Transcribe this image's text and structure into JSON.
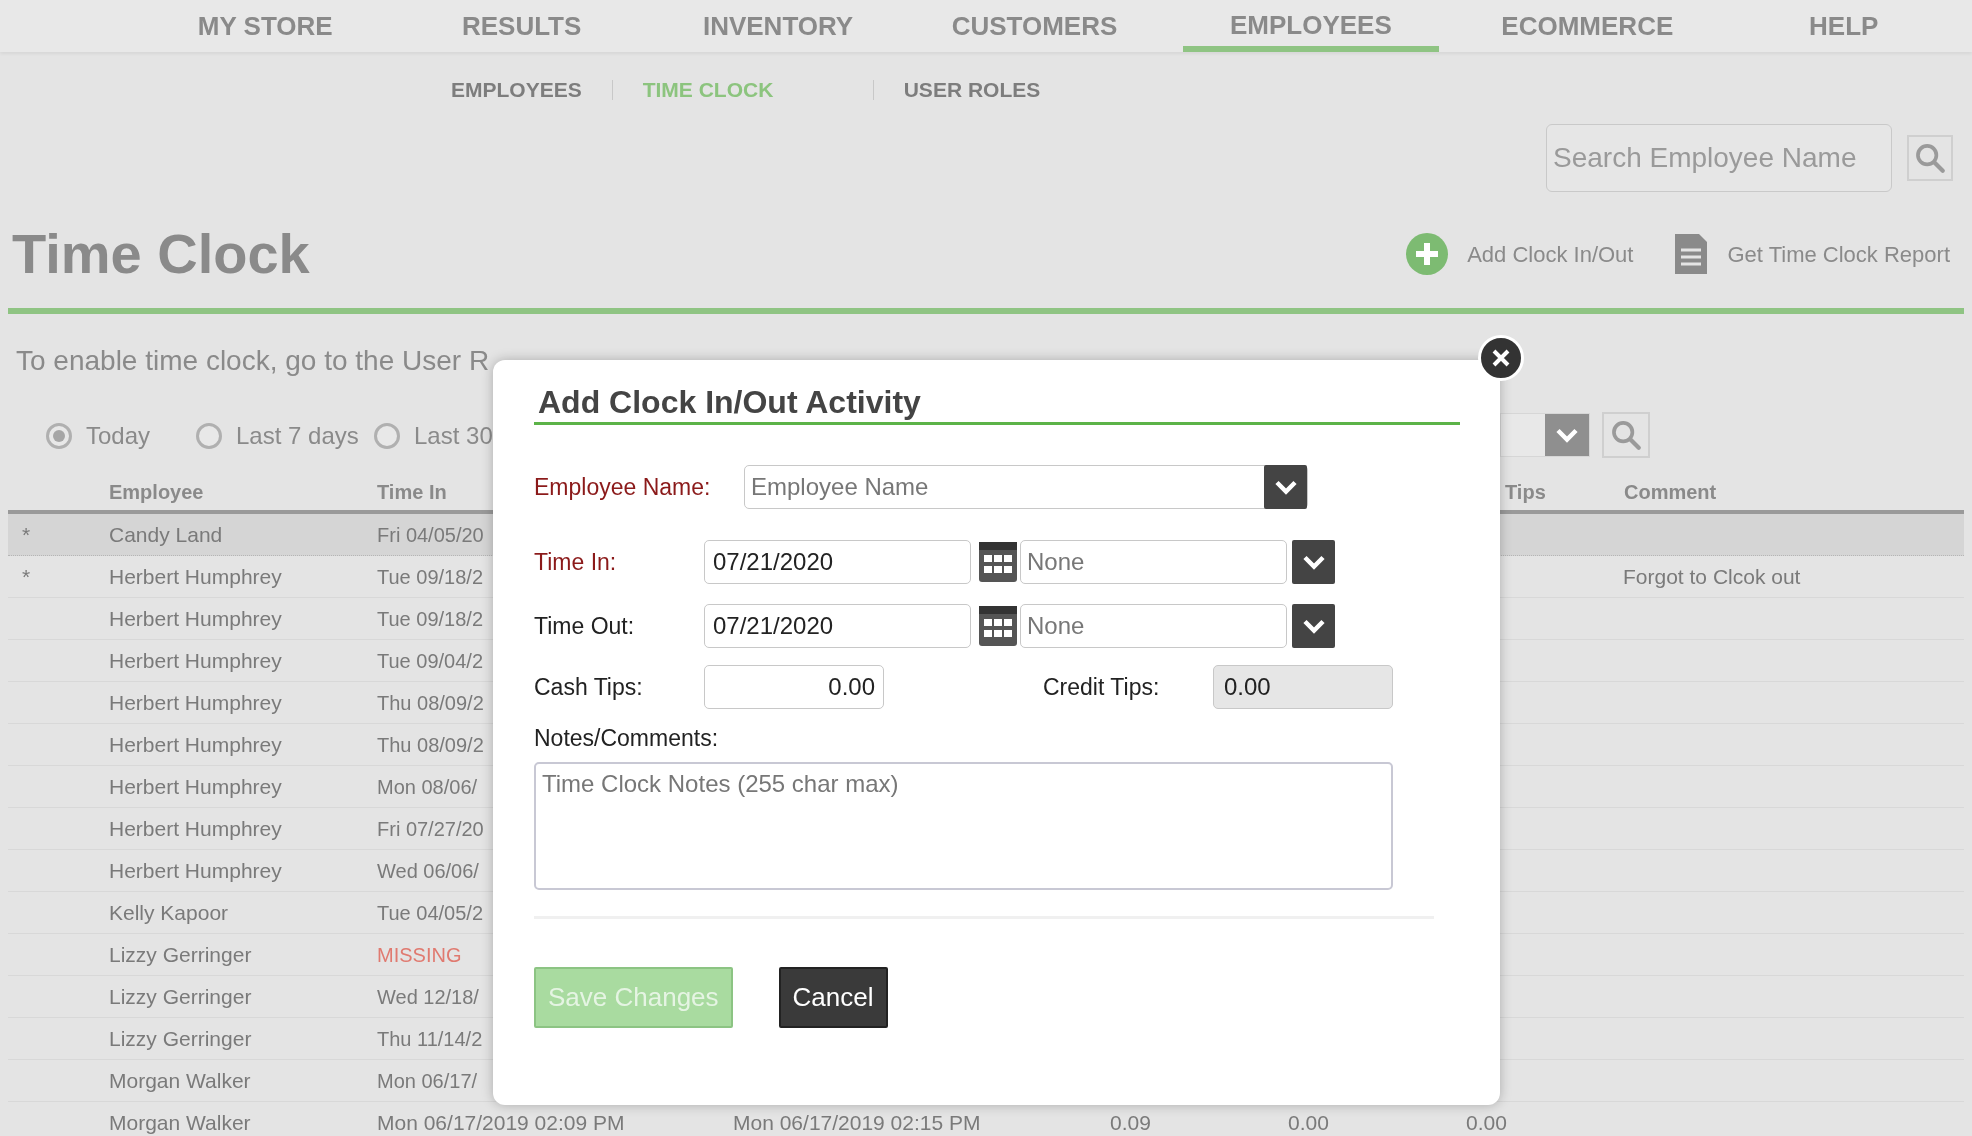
{
  "nav": [
    {
      "label": "MY STORE",
      "selected": false
    },
    {
      "label": "RESULTS",
      "selected": false
    },
    {
      "label": "INVENTORY",
      "selected": false
    },
    {
      "label": "CUSTOMERS",
      "selected": false
    },
    {
      "label": "EMPLOYEES",
      "selected": true
    },
    {
      "label": "ECOMMERCE",
      "selected": false
    },
    {
      "label": "HELP",
      "selected": false
    }
  ],
  "subnav": [
    {
      "label": "EMPLOYEES",
      "selected": false
    },
    {
      "label": "TIME CLOCK",
      "selected": true
    },
    {
      "label": "USER ROLES",
      "selected": false
    }
  ],
  "search": {
    "placeholder": "Search Employee Name"
  },
  "page_title": "Time Clock",
  "actions": [
    {
      "kind": "add",
      "label": "Add Clock In/Out"
    },
    {
      "kind": "report",
      "label": "Get Time Clock Report"
    }
  ],
  "notice": "To enable time clock, go to the User R",
  "ranges": [
    {
      "label": "Today",
      "selected": true
    },
    {
      "label": "Last 7 days",
      "selected": false
    },
    {
      "label": "Last 30",
      "selected": false
    }
  ],
  "table": {
    "columns": [
      "Employee",
      "Time In",
      "Tips",
      "Comment"
    ],
    "rows": [
      {
        "marker": "*",
        "employee": "Candy Land",
        "time_in": "Fri 04/05/20",
        "missing": false,
        "selected": true
      },
      {
        "marker": "*",
        "employee": "Herbert Humphrey",
        "time_in": "Tue 09/18/2",
        "missing": false,
        "selected": false,
        "comment": "Forgot to Clcok out"
      },
      {
        "employee": "Herbert Humphrey",
        "time_in": "Tue 09/18/2",
        "missing": false,
        "selected": false
      },
      {
        "employee": "Herbert Humphrey",
        "time_in": "Tue 09/04/2",
        "missing": false,
        "selected": false
      },
      {
        "employee": "Herbert Humphrey",
        "time_in": "Thu 08/09/2",
        "missing": false,
        "selected": false
      },
      {
        "employee": "Herbert Humphrey",
        "time_in": "Thu 08/09/2",
        "missing": false,
        "selected": false
      },
      {
        "employee": "Herbert Humphrey",
        "time_in": "Mon 08/06/",
        "missing": false,
        "selected": false
      },
      {
        "employee": "Herbert Humphrey",
        "time_in": "Fri 07/27/20",
        "missing": false,
        "selected": false
      },
      {
        "employee": "Herbert Humphrey",
        "time_in": "Wed 06/06/",
        "missing": false,
        "selected": false
      },
      {
        "employee": "Kelly Kapoor",
        "time_in": "Tue 04/05/2",
        "missing": false,
        "selected": false
      },
      {
        "employee": "Lizzy Gerringer",
        "time_in": "MISSING",
        "missing": true,
        "selected": false
      },
      {
        "employee": "Lizzy Gerringer",
        "time_in": "Wed 12/18/",
        "missing": false,
        "selected": false
      },
      {
        "employee": "Lizzy Gerringer",
        "time_in": "Thu 11/14/2",
        "missing": false,
        "selected": false
      },
      {
        "employee": "Morgan Walker",
        "time_in": "Mon 06/17/",
        "missing": false,
        "selected": false
      },
      {
        "employee": "Morgan Walker",
        "time_in": "Mon 06/17/2019 02:09 PM",
        "missing": false,
        "selected": false,
        "time_out": "Mon 06/17/2019 02:15 PM",
        "column_5": "0.09",
        "column_6": "0.00",
        "column_7": "0.00"
      }
    ]
  },
  "dialog": {
    "title": "Add Clock In/Out Activity",
    "employee": {
      "label": "Employee Name:",
      "placeholder": "Employee Name",
      "required": true
    },
    "time_in": {
      "label": "Time In:",
      "date": "07/21/2020",
      "time": "None",
      "required": true
    },
    "time_out": {
      "label": "Time Out:",
      "date": "07/21/2020",
      "time": "None",
      "required": false
    },
    "cash_tips": {
      "label": "Cash Tips:",
      "value": "0.00"
    },
    "credit_tips": {
      "label": "Credit Tips:",
      "value": "0.00",
      "disabled": true
    },
    "notes": {
      "label": "Notes/Comments:",
      "placeholder": "Time Clock Notes (255 char max)"
    },
    "buttons": [
      {
        "kind": "primary",
        "label": "Save Changes",
        "disabled": true
      },
      {
        "kind": "secondary",
        "label": "Cancel",
        "disabled": false
      }
    ]
  }
}
